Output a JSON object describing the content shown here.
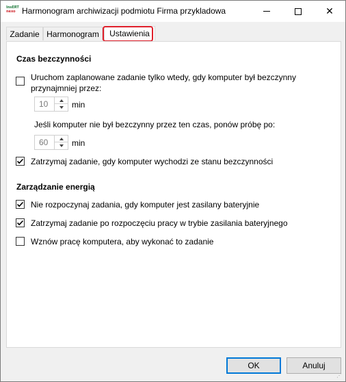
{
  "window": {
    "title": "Harmonogram archiwizacji podmiotu Firma przykladowa",
    "app_icon_line1": "InsERT",
    "app_icon_line2": "nexo",
    "close_glyph": "✕"
  },
  "tabs": [
    {
      "label": "Zadanie",
      "active": false
    },
    {
      "label": "Harmonogram",
      "active": false
    },
    {
      "label": "Ustawienia",
      "active": true
    }
  ],
  "idle": {
    "heading": "Czas bezczynności",
    "start_only_if_idle": {
      "checked": false,
      "label_line1": "Uruchom zaplanowane zadanie tylko wtedy, gdy komputer był bezczynny",
      "label_line2": "przynajmniej przez:"
    },
    "idle_minutes": {
      "value": "10",
      "unit": "min"
    },
    "retry_label": "Jeśli komputer nie był bezczynny przez ten czas, ponów próbę po:",
    "retry_minutes": {
      "value": "60",
      "unit": "min"
    },
    "stop_when_not_idle": {
      "checked": true,
      "label": "Zatrzymaj zadanie, gdy komputer wychodzi ze stanu bezczynności"
    }
  },
  "power": {
    "heading": "Zarządzanie energią",
    "dont_start_on_battery": {
      "checked": true,
      "label": "Nie rozpoczynaj zadania, gdy komputer jest zasilany bateryjnie"
    },
    "stop_on_battery": {
      "checked": true,
      "label": "Zatrzymaj zadanie po rozpoczęciu pracy w trybie zasilania bateryjnego"
    },
    "wake_to_run": {
      "checked": false,
      "label": "Wznów pracę komputera, aby wykonać to zadanie"
    }
  },
  "buttons": {
    "ok": "OK",
    "cancel": "Anuluj"
  }
}
